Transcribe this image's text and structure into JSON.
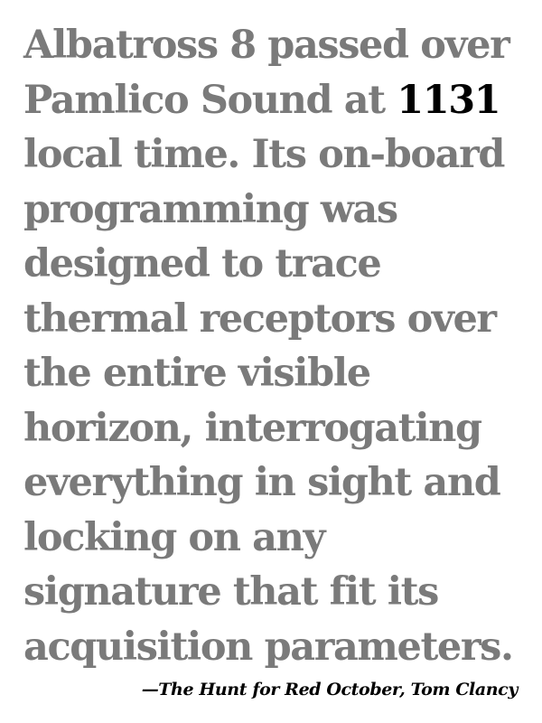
{
  "quote": {
    "lines": [
      {
        "before": "Albatross 8 passed over",
        "highlight": "",
        "after": ""
      },
      {
        "before": "Pamlico Sound at ",
        "highlight": "1131",
        "after": ""
      },
      {
        "before": "local time. Its on-board",
        "highlight": "",
        "after": ""
      },
      {
        "before": "programming was",
        "highlight": "",
        "after": ""
      },
      {
        "before": "designed to trace",
        "highlight": "",
        "after": ""
      },
      {
        "before": "thermal receptors over",
        "highlight": "",
        "after": ""
      },
      {
        "before": "the entire visible",
        "highlight": "",
        "after": ""
      },
      {
        "before": "horizon, interrogating",
        "highlight": "",
        "after": ""
      },
      {
        "before": "everything in sight and",
        "highlight": "",
        "after": ""
      },
      {
        "before": "locking on any",
        "highlight": "",
        "after": ""
      },
      {
        "before": "signature that fit its",
        "highlight": "",
        "after": ""
      },
      {
        "before": "acquisition parameters.",
        "highlight": "",
        "after": ""
      }
    ]
  },
  "attribution": "—The Hunt for Red October, Tom Clancy",
  "colors": {
    "text": "#7a7a7a",
    "highlight": "#000000",
    "background": "#ffffff"
  }
}
